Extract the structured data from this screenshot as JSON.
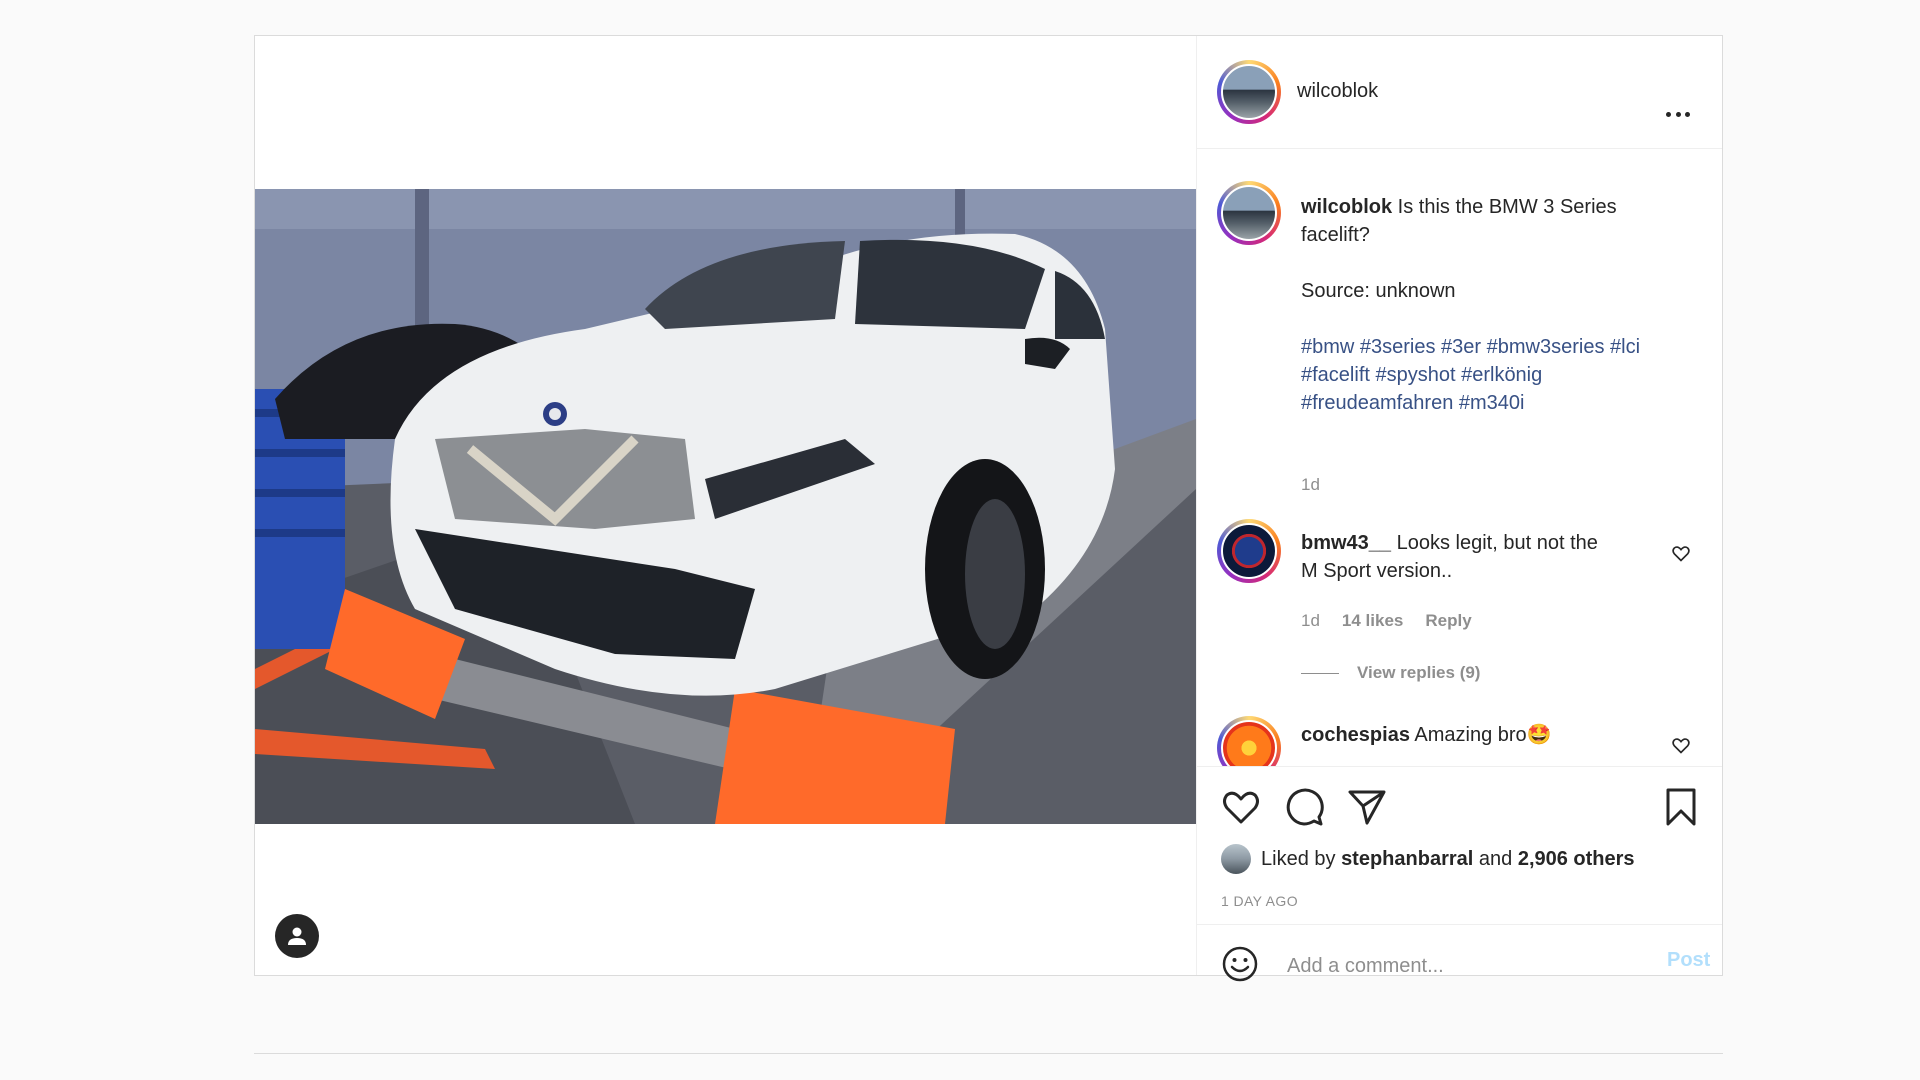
{
  "post": {
    "author": "wilcoblok",
    "more_icon": "more-horizontal-icon",
    "photo_alt": "car-photo",
    "caption": {
      "author": "wilcoblok",
      "line1": " Is this the BMW 3 Series",
      "line2": "facelift?",
      "source": "Source: unknown",
      "hashtags_line1": "#bmw #3series #3er #bmw3series #lci",
      "hashtags_line2": "#facelift #spyshot #erlkönig",
      "hashtags_line3": "#freudeamfahren #m340i",
      "time": "1d"
    },
    "comments": [
      {
        "author": "bmw43__",
        "text_line1": " Looks legit, but not the",
        "text_line2": "M Sport version..",
        "time": "1d",
        "likes": "14 likes",
        "reply": "Reply",
        "view_replies": "View replies (9)"
      },
      {
        "author": "cochespias",
        "text": " Amazing bro🤩"
      }
    ],
    "likes": {
      "prefix": "Liked by",
      "user": "stephanbarral",
      "joiner": "and",
      "others": "2,906 others"
    },
    "timestamp": "1 DAY AGO",
    "comment_input": {
      "placeholder": "Add a comment...",
      "post_label": "Post"
    }
  },
  "colors": {
    "hashtag": "#385185",
    "post_button": "#b2dffc",
    "muted": "#8e8e8e"
  }
}
